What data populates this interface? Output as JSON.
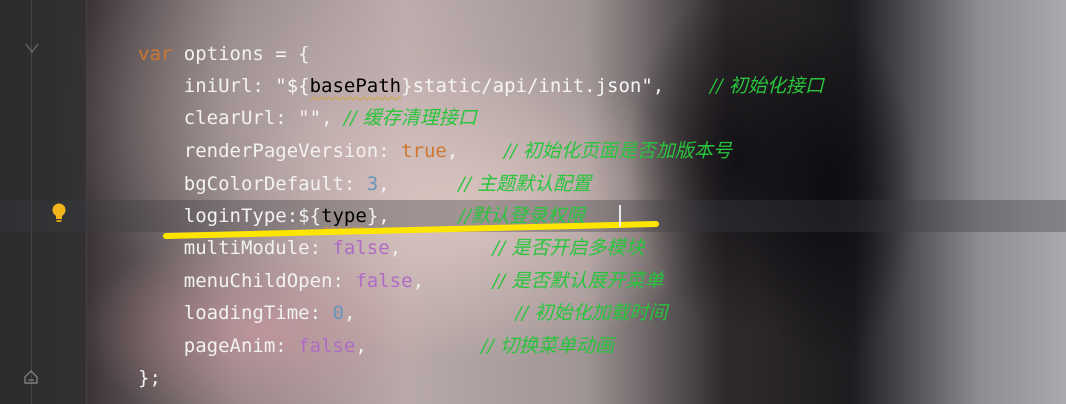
{
  "editor": {
    "lines": [
      {
        "parts": [
          {
            "t": "var",
            "c": "kw"
          },
          {
            "t": " options = {",
            "c": "id"
          }
        ]
      },
      {
        "parts": [
          {
            "t": "    iniUrl",
            "c": "prop"
          },
          {
            "t": ": ",
            "c": "punc"
          },
          {
            "t": "\"${",
            "c": "str"
          },
          {
            "t": "basePath",
            "c": "squiggle"
          },
          {
            "t": "}",
            "c": "str"
          },
          {
            "t": "static/api/init.json\"",
            "c": "str"
          },
          {
            "t": ",    ",
            "c": "punc"
          },
          {
            "t": "// 初始化接口",
            "c": "cmt"
          }
        ]
      },
      {
        "parts": [
          {
            "t": "    clearUrl",
            "c": "prop"
          },
          {
            "t": ": ",
            "c": "punc"
          },
          {
            "t": "\"\"",
            "c": "str"
          },
          {
            "t": ", ",
            "c": "punc"
          },
          {
            "t": "// 缓存清理接口",
            "c": "cmt"
          }
        ]
      },
      {
        "parts": [
          {
            "t": "    renderPageVersion",
            "c": "prop"
          },
          {
            "t": ": ",
            "c": "punc"
          },
          {
            "t": "true",
            "c": "bool"
          },
          {
            "t": ",    ",
            "c": "punc"
          },
          {
            "t": "// 初始化页面是否加版本号",
            "c": "cmt"
          }
        ]
      },
      {
        "parts": [
          {
            "t": "    bgColorDefault",
            "c": "prop"
          },
          {
            "t": ": ",
            "c": "punc"
          },
          {
            "t": "3",
            "c": "num"
          },
          {
            "t": ",      ",
            "c": "punc"
          },
          {
            "t": "// 主题默认配置",
            "c": "cmt"
          }
        ]
      },
      {
        "parts": [
          {
            "t": "    loginType",
            "c": "prop"
          },
          {
            "t": ":${",
            "c": "punc"
          },
          {
            "t": "type",
            "c": "squiggle"
          },
          {
            "t": "},      ",
            "c": "punc"
          },
          {
            "t": "//默认登录权限",
            "c": "cmt"
          }
        ]
      },
      {
        "parts": [
          {
            "t": "    multiModule",
            "c": "prop"
          },
          {
            "t": ": ",
            "c": "punc"
          },
          {
            "t": "false",
            "c": "bool-purple"
          },
          {
            "t": ",        ",
            "c": "punc"
          },
          {
            "t": "// 是否开启多模块",
            "c": "cmt"
          }
        ]
      },
      {
        "parts": [
          {
            "t": "    menuChildOpen",
            "c": "prop"
          },
          {
            "t": ": ",
            "c": "punc"
          },
          {
            "t": "false",
            "c": "bool-purple"
          },
          {
            "t": ",      ",
            "c": "punc"
          },
          {
            "t": "// 是否默认展开菜单",
            "c": "cmt"
          }
        ]
      },
      {
        "parts": [
          {
            "t": "    loadingTime",
            "c": "prop"
          },
          {
            "t": ": ",
            "c": "punc"
          },
          {
            "t": "0",
            "c": "num"
          },
          {
            "t": ",              ",
            "c": "punc"
          },
          {
            "t": "// 初始化加载时间",
            "c": "cmt"
          }
        ]
      },
      {
        "parts": [
          {
            "t": "    pageAnim",
            "c": "prop"
          },
          {
            "t": ": ",
            "c": "punc"
          },
          {
            "t": "false",
            "c": "bool-purple"
          },
          {
            "t": ",          ",
            "c": "punc"
          },
          {
            "t": "// 切换菜单动画",
            "c": "cmt"
          }
        ]
      },
      {
        "parts": [
          {
            "t": "};",
            "c": "punc"
          }
        ]
      }
    ],
    "line_tops": [
      38,
      70,
      102,
      135,
      168,
      200,
      232,
      265,
      297,
      330,
      362
    ]
  },
  "colors": {
    "keyword": "#cc7832",
    "comment": "#28c43c",
    "number": "#6897bb",
    "highlight_marker": "#ffe600",
    "bulb": "#f2b51a"
  },
  "icons": {
    "bulb": "lightbulb-icon",
    "fold": "fold-icon"
  }
}
